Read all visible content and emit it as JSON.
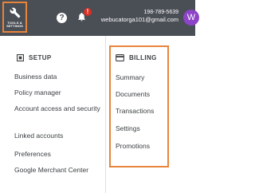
{
  "topbar": {
    "tools_label_line1": "TOOLS &",
    "tools_label_line2": "SETTINGS",
    "help_glyph": "?",
    "notification_count": "!",
    "account_id": "198-789-5639",
    "account_email": "webucatorga101@gmail.com",
    "avatar_letter": "W"
  },
  "setup": {
    "title": "SETUP",
    "items": [
      {
        "label": "Business data"
      },
      {
        "label": "Policy manager"
      },
      {
        "label": "Account access and security"
      },
      {
        "label": "Linked accounts"
      },
      {
        "label": "Preferences"
      },
      {
        "label": "Google Merchant Center"
      }
    ]
  },
  "billing": {
    "title": "BILLING",
    "items": [
      {
        "label": "Summary"
      },
      {
        "label": "Documents"
      },
      {
        "label": "Transactions"
      },
      {
        "label": "Settings"
      },
      {
        "label": "Promotions"
      }
    ]
  },
  "colors": {
    "topbar": "#4a4e55",
    "highlight": "#e8843c",
    "notification": "#d93025",
    "avatar": "#8e44c8"
  },
  "icons": [
    "wrench-icon",
    "help-icon",
    "bell-icon",
    "setup-icon",
    "billing-icon"
  ]
}
